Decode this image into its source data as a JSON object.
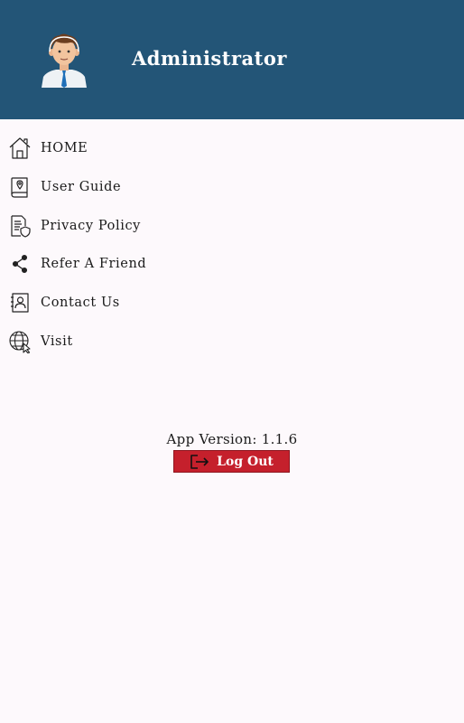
{
  "header": {
    "user_name": "Administrator",
    "background_color": "#235577"
  },
  "menu": {
    "items": [
      {
        "label": "HOME",
        "icon": "home-icon"
      },
      {
        "label": "User Guide",
        "icon": "guide-book-icon"
      },
      {
        "label": "Privacy Policy",
        "icon": "privacy-document-icon"
      },
      {
        "label": "Refer A Friend",
        "icon": "share-icon"
      },
      {
        "label": "Contact Us",
        "icon": "contact-card-icon"
      },
      {
        "label": "Visit",
        "icon": "globe-cursor-icon"
      }
    ]
  },
  "footer": {
    "app_version": "App Version: 1.1.6",
    "logout_label": "Log Out",
    "logout_color": "#c5202c"
  }
}
